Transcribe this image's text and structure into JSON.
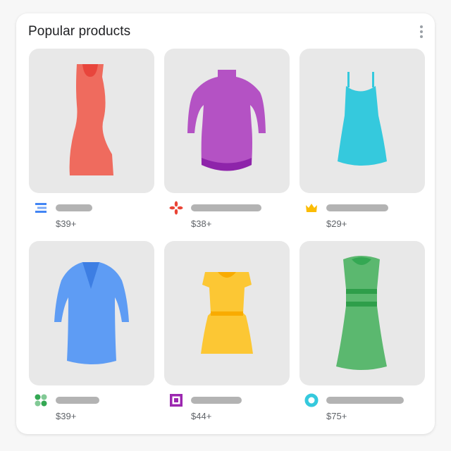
{
  "title": "Popular products",
  "menu_icon": "more-vert-icon",
  "products": [
    {
      "price": "$39+",
      "logo_icon": "bars-logo-icon",
      "color": "#ef6b5e"
    },
    {
      "price": "$38+",
      "logo_icon": "flower-logo-icon",
      "color": "#b452c4"
    },
    {
      "price": "$29+",
      "logo_icon": "crown-logo-icon",
      "color": "#35c9dd"
    },
    {
      "price": "$39+",
      "logo_icon": "four-dots-logo-icon",
      "color": "#5e9cf4"
    },
    {
      "price": "$44+",
      "logo_icon": "square-logo-icon",
      "color": "#fcc734"
    },
    {
      "price": "$75+",
      "logo_icon": "ring-logo-icon",
      "color": "#5bb86f"
    }
  ]
}
